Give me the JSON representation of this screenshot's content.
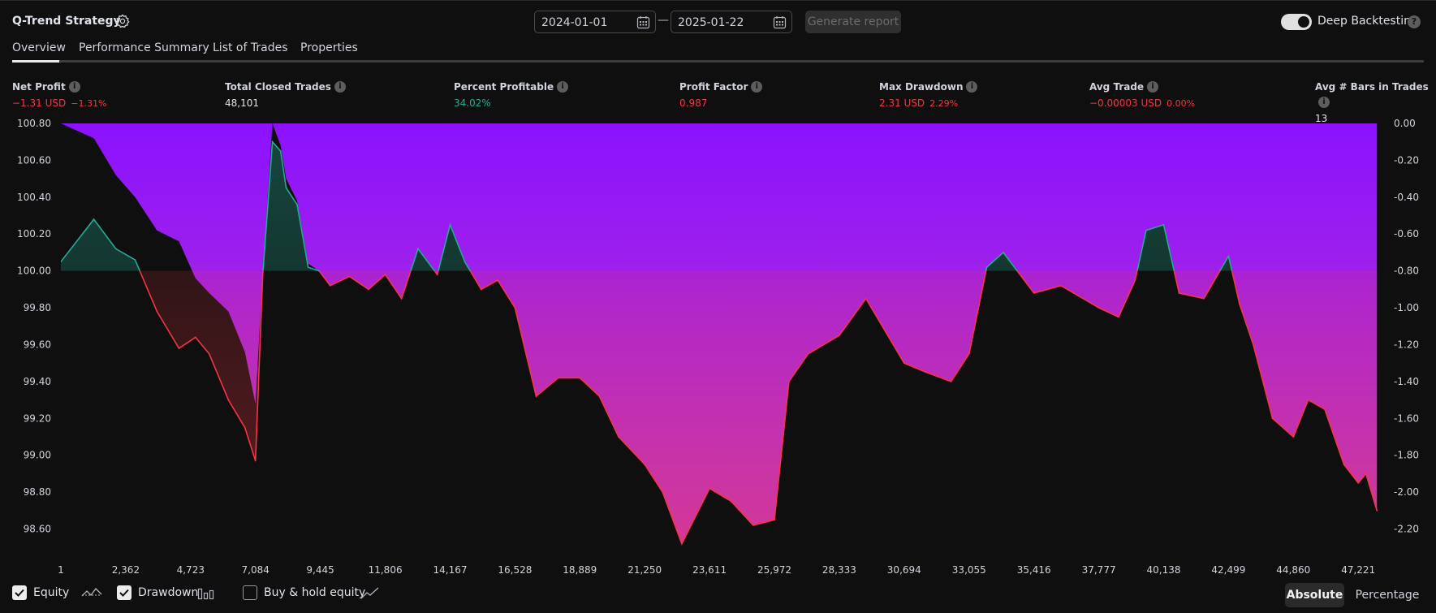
{
  "header": {
    "strategy_title": "Q-Trend Strategy",
    "date_from": "2024-01-01",
    "date_separator": "—",
    "date_to": "2025-01-22",
    "generate_button": "Generate report",
    "deep_backtesting_label": "Deep Backtesting",
    "deep_backtesting_on": true,
    "help_glyph": "?"
  },
  "tabs": [
    {
      "label": "Overview",
      "active": true
    },
    {
      "label": "Performance Summary",
      "active": false
    },
    {
      "label": "List of Trades",
      "active": false
    },
    {
      "label": "Properties",
      "active": false
    }
  ],
  "metrics": [
    {
      "label": "Net Profit",
      "value": "−1.31 USD",
      "sub": "−1.31%",
      "tone": "red"
    },
    {
      "label": "Total Closed Trades",
      "value": "48,101",
      "sub": "",
      "tone": "white"
    },
    {
      "label": "Percent Profitable",
      "value": "34.02%",
      "sub": "",
      "tone": "green"
    },
    {
      "label": "Profit Factor",
      "value": "0.987",
      "sub": "",
      "tone": "red"
    },
    {
      "label": "Max Drawdown",
      "value": "2.31 USD",
      "sub": "2.29%",
      "tone": "red"
    },
    {
      "label": "Avg Trade",
      "value": "−0.00003 USD",
      "sub": "0.00%",
      "tone": "red"
    },
    {
      "label": "Avg # Bars in Trades",
      "value": "13",
      "sub": "",
      "tone": "white"
    }
  ],
  "metric_info_glyph": "i",
  "colors": {
    "profit": "#22ab94",
    "loss": "#f23645",
    "drawdown_top": "#8b12ff",
    "drawdown_bottom": "#c23ac4",
    "background": "#0f0f0f"
  },
  "chart_data": {
    "type": "area",
    "title": "",
    "series": [
      {
        "name": "Equity",
        "axis": "left",
        "x": [
          1,
          1200,
          2000,
          2700,
          3500,
          4300,
          4900,
          5400,
          6100,
          6700,
          7084,
          7350,
          7700,
          8000,
          8200,
          8600,
          9000,
          9400,
          9800,
          10500,
          11200,
          11806,
          12400,
          13000,
          13700,
          14167,
          14700,
          15300,
          15900,
          16528,
          17300,
          18100,
          18889,
          19600,
          20300,
          21250,
          21900,
          22600,
          23611,
          24400,
          25200,
          25972,
          26500,
          27200,
          28333,
          29300,
          30694,
          31500,
          32400,
          33055,
          33700,
          34300,
          35416,
          36400,
          37777,
          38500,
          39100,
          39500,
          40138,
          40700,
          41600,
          42499,
          42900,
          43400,
          44100,
          44860,
          45400,
          46000,
          46700,
          47221,
          47500,
          47900
        ],
        "y": [
          100.05,
          100.28,
          100.12,
          100.06,
          99.78,
          99.58,
          99.64,
          99.55,
          99.3,
          99.15,
          98.97,
          99.98,
          100.7,
          100.65,
          100.45,
          100.36,
          100.02,
          100.0,
          99.92,
          99.97,
          99.9,
          99.98,
          99.85,
          100.12,
          99.98,
          100.25,
          100.05,
          99.9,
          99.95,
          99.8,
          99.32,
          99.42,
          99.42,
          99.32,
          99.1,
          98.95,
          98.8,
          98.52,
          98.82,
          98.75,
          98.62,
          98.65,
          99.4,
          99.55,
          99.65,
          99.85,
          99.5,
          99.45,
          99.4,
          99.55,
          100.02,
          100.1,
          99.88,
          99.92,
          99.8,
          99.75,
          99.95,
          100.22,
          100.25,
          99.88,
          99.85,
          100.08,
          99.82,
          99.6,
          99.2,
          99.1,
          99.3,
          99.25,
          98.95,
          98.85,
          98.9,
          98.7
        ]
      },
      {
        "name": "Drawdown",
        "axis": "right",
        "x": [
          1,
          1200,
          2000,
          2700,
          3500,
          4300,
          4900,
          5400,
          6100,
          6700,
          7084,
          7350,
          7700,
          8000,
          8200,
          8600,
          9000,
          9400,
          9800,
          10500,
          11200,
          11806,
          12400,
          13000,
          13700,
          14167,
          14700,
          15300,
          15900,
          16528,
          17300,
          18100,
          18889,
          19600,
          20300,
          21250,
          21900,
          22600,
          23611,
          24400,
          25200,
          25972,
          26500,
          27200,
          28333,
          29300,
          30694,
          31500,
          32400,
          33055,
          33700,
          34300,
          35416,
          36400,
          37777,
          38500,
          39100,
          39500,
          40138,
          40700,
          41600,
          42499,
          42900,
          43400,
          44100,
          44860,
          45400,
          46000,
          46700,
          47221,
          47500,
          47900
        ],
        "y": [
          0.0,
          -0.08,
          -0.28,
          -0.4,
          -0.58,
          -0.64,
          -0.84,
          -0.92,
          -1.02,
          -1.24,
          -1.52,
          -0.8,
          0.0,
          -0.12,
          -0.3,
          -0.42,
          -0.76,
          -0.8,
          -0.88,
          -0.83,
          -0.9,
          -0.82,
          -0.95,
          -0.68,
          -0.82,
          -0.55,
          -0.75,
          -0.9,
          -0.85,
          -1.0,
          -1.48,
          -1.38,
          -1.38,
          -1.48,
          -1.7,
          -1.85,
          -2.0,
          -2.28,
          -1.98,
          -2.05,
          -2.18,
          -2.15,
          -1.4,
          -1.25,
          -1.15,
          -0.95,
          -1.3,
          -1.35,
          -1.4,
          -1.25,
          -0.78,
          -0.7,
          -0.92,
          -0.88,
          -1.0,
          -1.05,
          -0.85,
          -0.58,
          -0.55,
          -0.92,
          -0.95,
          -0.72,
          -0.98,
          -1.2,
          -1.6,
          -1.7,
          -1.5,
          -1.55,
          -1.85,
          -1.95,
          -1.9,
          -2.1
        ]
      }
    ],
    "baseline": 100.0,
    "left_axis": {
      "ticks": [
        "100.80",
        "100.60",
        "100.40",
        "100.20",
        "100.00",
        "99.80",
        "99.60",
        "99.40",
        "99.20",
        "99.00",
        "98.80",
        "98.60"
      ],
      "ylim": [
        98.51,
        100.8
      ]
    },
    "right_axis": {
      "ticks": [
        "0.00",
        "-0.20",
        "-0.40",
        "-0.60",
        "-0.80",
        "-1.00",
        "-1.20",
        "-1.40",
        "-1.60",
        "-1.80",
        "-2.00",
        "-2.20"
      ],
      "ylim": [
        -2.29,
        0.0
      ]
    },
    "x_axis": {
      "ticks": [
        "1",
        "2,362",
        "4,723",
        "7,084",
        "9,445",
        "11,806",
        "14,167",
        "16,528",
        "18,889",
        "21,250",
        "23,611",
        "25,972",
        "28,333",
        "30,694",
        "33,055",
        "35,416",
        "37,777",
        "40,138",
        "42,499",
        "44,860",
        "47,221"
      ],
      "xlim": [
        1,
        48101
      ]
    },
    "grid": false,
    "legend": "bottom-left"
  },
  "bottom": {
    "equity_label": "Equity",
    "equity_checked": true,
    "drawdown_label": "Drawdown",
    "drawdown_checked": true,
    "buyhold_label": "Buy & hold equity",
    "buyhold_checked": false,
    "absolute_label": "Absolute",
    "percentage_label": "Percentage",
    "mode": "Absolute"
  }
}
